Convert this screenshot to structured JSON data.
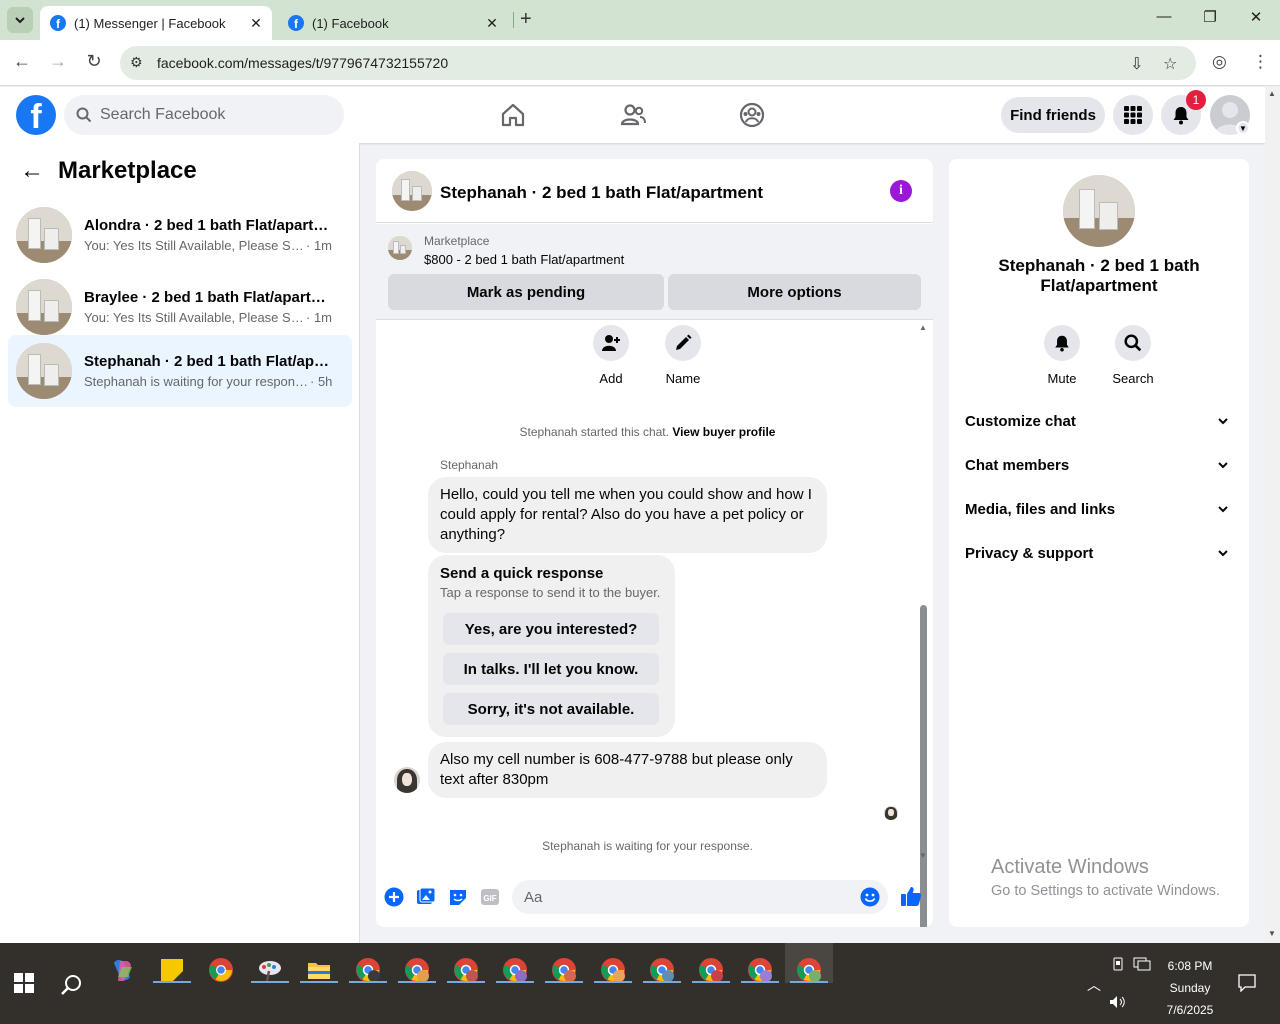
{
  "browser": {
    "tabs": [
      {
        "title": "(1) Messenger | Facebook",
        "active": true
      },
      {
        "title": "(1) Facebook",
        "active": false
      }
    ],
    "url": "facebook.com/messages/t/9779674732155720"
  },
  "fb_header": {
    "search_placeholder": "Search Facebook",
    "find_friends_label": "Find friends",
    "notification_count": "1"
  },
  "sidebar": {
    "title": "Marketplace",
    "conversations": [
      {
        "name": "Alondra · 2 bed 1 bath Flat/apartm...",
        "snippet": "You: Yes Its Still Available, Please Sen...",
        "time": "· 1m",
        "active": false
      },
      {
        "name": "Braylee · 2 bed 1 bath Flat/apartm...",
        "snippet": "You: Yes Its Still Available, Please Sen...",
        "time": "· 1m",
        "active": false
      },
      {
        "name": "Stephanah · 2 bed 1 bath Flat/apar...",
        "snippet": "Stephanah is waiting for your response.",
        "time": "· 5h",
        "active": true
      }
    ]
  },
  "chat": {
    "title": "Stephanah · 2 bed 1 bath Flat/apartment",
    "listing": {
      "source": "Marketplace",
      "price_title": "$800 - 2 bed 1 bath Flat/apartment",
      "mark_pending_label": "Mark as pending",
      "more_options_label": "More options"
    },
    "actions": [
      {
        "label": "Add",
        "icon": "add-person-icon"
      },
      {
        "label": "Name",
        "icon": "pencil-icon"
      }
    ],
    "started_text": "Stephanah started this chat.",
    "view_profile_label": "View buyer profile",
    "sender_name": "Stephanah",
    "message_1": "Hello, could you tell me when you could show and how I could apply for rental? Also do you have a pet policy or anything?",
    "quick_response": {
      "title": "Send a quick response",
      "subtitle": "Tap a response to send it to the buyer.",
      "options": [
        "Yes, are you interested?",
        "In talks. I'll let you know.",
        "Sorry, it's not available."
      ]
    },
    "message_2": "Also my cell number is 608-477-9788 but please only text after 830pm",
    "waiting_text": "Stephanah is waiting for your response.",
    "composer_placeholder": "Aa"
  },
  "details": {
    "title": "Stephanah · 2 bed 1 bath Flat/apartment",
    "actions": [
      {
        "label": "Mute",
        "icon": "bell-icon"
      },
      {
        "label": "Search",
        "icon": "search-icon"
      }
    ],
    "sections": [
      "Customize chat",
      "Chat members",
      "Media, files and links",
      "Privacy & support"
    ]
  },
  "watermark": {
    "line1": "Activate Windows",
    "line2": "Go to Settings to activate Windows."
  },
  "taskbar": {
    "time": "6:08 PM",
    "day": "Sunday",
    "date": "7/6/2025"
  },
  "colors": {
    "fb_blue": "#1877f2",
    "info_purple": "#9b18d9",
    "badge_red": "#e41e3f",
    "active_conv_bg": "#ebf5ff"
  }
}
